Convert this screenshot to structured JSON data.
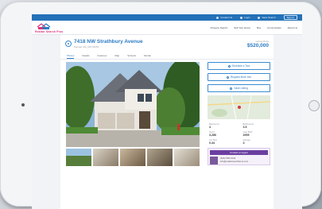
{
  "topbar": {
    "links": [
      "Contact Us",
      "Login",
      "Save Search"
    ],
    "signin": "Sign In"
  },
  "brand": {
    "logo_text": "Realtor Search Pros",
    "logo_color": "#d9327a"
  },
  "nav": {
    "items": [
      "Property Search",
      "Sell Your Home",
      "Buy",
      "Communities",
      "About Us"
    ]
  },
  "listing": {
    "address": "7418 NW Strathbury Avenue",
    "subtitle": "Kansas City, MO 64151",
    "price_label": "Listing Price",
    "price": "$520,000",
    "tabs": [
      "Photos",
      "Details",
      "Features",
      "Map",
      "Schools",
      "Similar"
    ],
    "active_tab": "Photos"
  },
  "sidebar": {
    "buttons": [
      "Schedule a Tour",
      "Request More Info",
      "Save Listing"
    ],
    "stats": [
      {
        "k": "Bedrooms",
        "v": "4"
      },
      {
        "k": "Bathrooms",
        "v": "3.5"
      },
      {
        "k": "Sq Ft",
        "v": "3,286"
      },
      {
        "k": "Year Built",
        "v": "2005"
      },
      {
        "k": "Lot Size",
        "v": "0.34"
      },
      {
        "k": "Garage",
        "v": "3"
      }
    ],
    "agent_title": "Contact an Agent",
    "agent_lines": [
      "(816) 555-0143",
      "info@realtorsearchpros.com"
    ]
  },
  "colors": {
    "primary": "#2471b8",
    "accent": "#2b7bc4",
    "agent": "#6b3fa0"
  }
}
